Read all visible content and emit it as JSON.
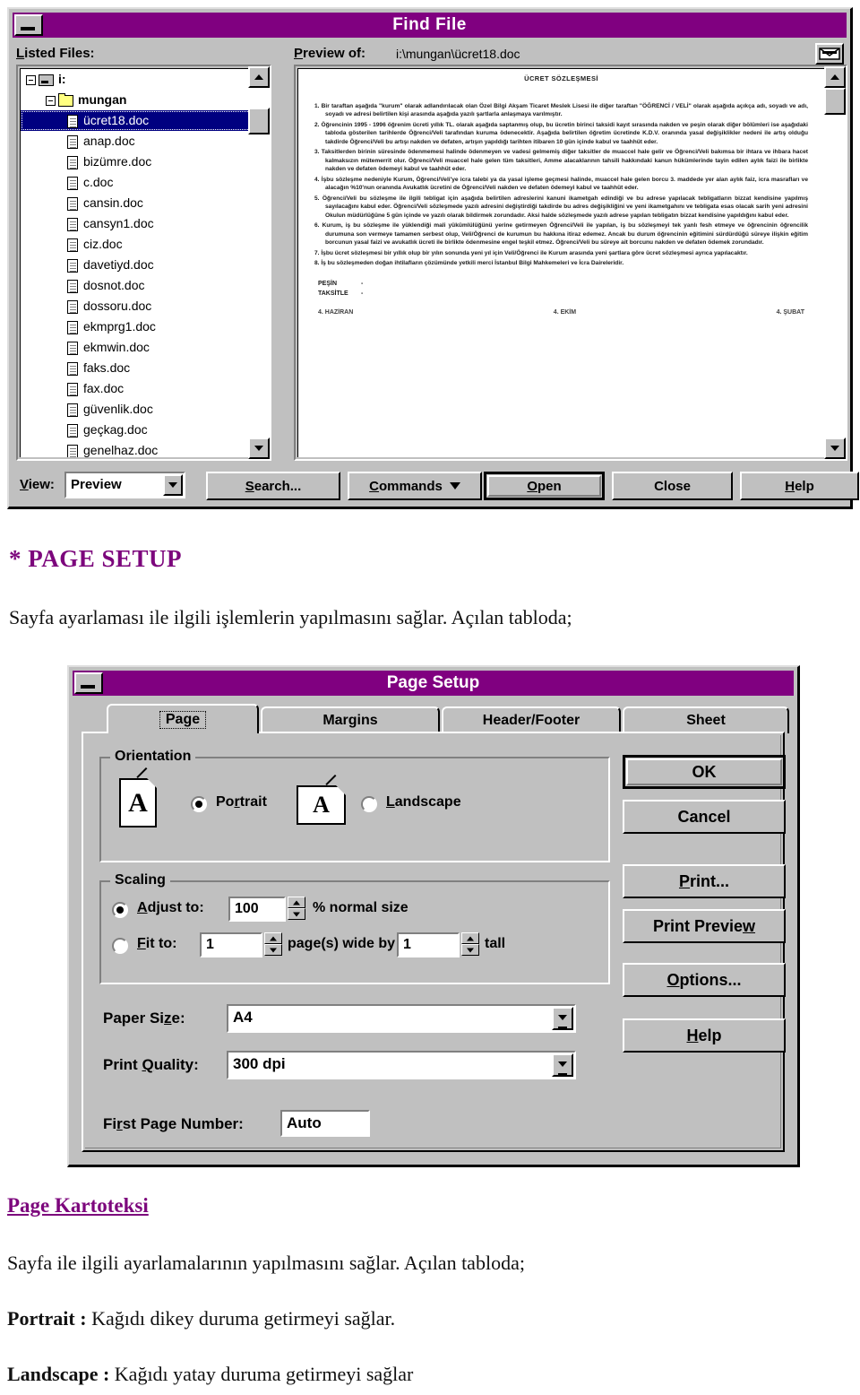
{
  "find_file": {
    "title": "Find File",
    "minimize_label": "Minimize",
    "listed_files_label": "Listed Files:",
    "preview_of_label": "Preview of:",
    "preview_path": "i:\\mungan\\ücret18.doc",
    "preview_toggle_icon": "envelope-icon",
    "tree": [
      {
        "label": "i:",
        "icon": "drive-icon",
        "indent": 0,
        "expander": true,
        "bold": true,
        "selected": false
      },
      {
        "label": "mungan",
        "icon": "folder-icon",
        "indent": 1,
        "expander": true,
        "bold": true,
        "selected": false
      },
      {
        "label": "ücret18.doc",
        "icon": "document-icon",
        "indent": 2,
        "expander": false,
        "bold": false,
        "selected": true
      },
      {
        "label": "anap.doc",
        "icon": "document-icon",
        "indent": 2,
        "expander": false,
        "bold": false,
        "selected": false
      },
      {
        "label": "bizümre.doc",
        "icon": "document-icon",
        "indent": 2,
        "expander": false,
        "bold": false,
        "selected": false
      },
      {
        "label": "c.doc",
        "icon": "document-icon",
        "indent": 2,
        "expander": false,
        "bold": false,
        "selected": false
      },
      {
        "label": "cansin.doc",
        "icon": "document-icon",
        "indent": 2,
        "expander": false,
        "bold": false,
        "selected": false
      },
      {
        "label": "cansyn1.doc",
        "icon": "document-icon",
        "indent": 2,
        "expander": false,
        "bold": false,
        "selected": false
      },
      {
        "label": "ciz.doc",
        "icon": "document-icon",
        "indent": 2,
        "expander": false,
        "bold": false,
        "selected": false
      },
      {
        "label": "davetiyd.doc",
        "icon": "document-icon",
        "indent": 2,
        "expander": false,
        "bold": false,
        "selected": false
      },
      {
        "label": "dosnot.doc",
        "icon": "document-icon",
        "indent": 2,
        "expander": false,
        "bold": false,
        "selected": false
      },
      {
        "label": "dossoru.doc",
        "icon": "document-icon",
        "indent": 2,
        "expander": false,
        "bold": false,
        "selected": false
      },
      {
        "label": "ekmprg1.doc",
        "icon": "document-icon",
        "indent": 2,
        "expander": false,
        "bold": false,
        "selected": false
      },
      {
        "label": "ekmwin.doc",
        "icon": "document-icon",
        "indent": 2,
        "expander": false,
        "bold": false,
        "selected": false
      },
      {
        "label": "faks.doc",
        "icon": "document-icon",
        "indent": 2,
        "expander": false,
        "bold": false,
        "selected": false
      },
      {
        "label": "fax.doc",
        "icon": "document-icon",
        "indent": 2,
        "expander": false,
        "bold": false,
        "selected": false
      },
      {
        "label": "güvenlik.doc",
        "icon": "document-icon",
        "indent": 2,
        "expander": false,
        "bold": false,
        "selected": false
      },
      {
        "label": "geçkag.doc",
        "icon": "document-icon",
        "indent": 2,
        "expander": false,
        "bold": false,
        "selected": false
      },
      {
        "label": "genelhaz.doc",
        "icon": "document-icon",
        "indent": 2,
        "expander": false,
        "bold": false,
        "selected": false
      }
    ],
    "document_preview": {
      "heading": "ÜCRET SÖZLEŞMESİ",
      "paragraphs": [
        "1. Bir taraftan aşağıda \"kurum\" olarak adlandırılacak olan Özel Bilgi Akşam Ticaret Meslek Lisesi ile diğer taraftan \"ÖĞRENCİ / VELİ\" olarak aşağıda açıkça adı, soyadı ve adı, soyadı ve adresi belirtilen kişi arasında aşağıda yazılı şartlarla anlaşmaya varılmıştır.",
        "2. Öğrencinin 1995 - 1996 öğrenim ücreti yıllık TL. olarak aşağıda saptanmış olup, bu ücretin birinci taksidi kayıt sırasında nakden ve peşin olarak diğer bölümleri ise aşağıdaki tabloda gösterilen tarihlerde Öğrenci/Veli tarafından kuruma ödenecektir. Aşağıda belirtilen öğretim ücretinde K.D.V. oranında yasal değişiklikler nedeni ile artış olduğu takdirde Öğrenci/Veli bu artışı nakden ve defaten, artışın yapıldığı tarihten itibaren 10 gün içinde kabul ve taahhüt eder.",
        "3. Taksitlerden birinin süresinde ödenmemesi halinde ödenmeyen ve vadesi gelmemiş diğer taksitler de muaccel hale gelir ve Öğrenci/Veli bakımsa bir ihtara ve ihbara hacet kalmaksızın mütemerrit olur. Öğrenci/Veli muaccel hale gelen tüm taksitleri, Amme alacaklarının tahsili hakkındaki kanun hükümlerinde tayin edilen aylık faizi ile birlikte nakden ve defaten ödemeyi kabul ve taahhüt eder.",
        "4. İşbu sözleşme nedeniyle Kurum, Öğrenci/Veli'ye icra talebi ya da yasal işleme geçmesi halinde, muaccel hale gelen borcu 3. maddede yer alan aylık faiz, icra masrafları ve alacağın %10'nun oranında Avukatlık ücretini de Öğrenci/Veli nakden ve defaten ödemeyi kabul ve taahhüt eder.",
        "5. Öğrenci/Veli bu sözleşme ile ilgili tebligat için aşağıda belirtilen adreslerini kanuni ikametgah edindiği ve bu adrese yapılacak tebligatların bizzat kendisine yapılmış sayılacağını kabul eder. Öğrenci/Veli sözleşmede yazılı adresini değiştirdiği takdirde bu adres değişikliğini ve yeni ikametgahını ve tebligata esas olacak sarih yeni adresini Okulun müdürlüğüne 5 gün içinde ve yazılı olarak bildirmek zorundadır. Aksi halde sözleşmede yazılı adrese yapılan tebligatın bizzat kendisine yapıldığını kabul eder.",
        "6. Kurum, iş bu sözleşme ile yüklendiği mali yükümlülüğünü yerine getirmeyen Öğrenci/Veli ile yapılan, iş bu sözleşmeyi tek yanlı fesh etmeye ve öğrencinin öğrencilik durumuna son vermeye tamamen serbest olup, Veli/Öğrenci de kurumun bu hakkına itiraz edemez. Ancak bu durum öğrencinin eğitimini sürdürdüğü süreye ilişkin eğitim borcunun yasal faizi ve avukatlık ücreti ile birlikte ödenmesine engel teşkil etmez. Öğrenci/Veli bu süreye ait borcunu nakden ve defaten ödemek zorundadır.",
        "7. İşbu ücret sözleşmesi bir yıllık olup bir yılın sonunda yeni yıl için Veli/Öğrenci ile Kurum arasında yeni şartlara göre ücret sözleşmesi ayrıca yapılacaktır.",
        "8. İş bu sözleşmeden doğan ihtilafların çözümünde yetkili merci İstanbul Bilgi Mahkemeleri ve İcra Daireleridir."
      ],
      "signature_lines": [
        {
          "label": "PEŞİN",
          "value": "-"
        },
        {
          "label": "TAKSİTLE",
          "value": "-"
        }
      ],
      "footer_cells": [
        "4. HAZİRAN",
        "4. EKİM",
        "4. ŞUBAT"
      ]
    },
    "toolbar": {
      "view_label": "View:",
      "view_value": "Preview",
      "search_label": "Search...",
      "commands_label": "Commands",
      "open_label": "Open",
      "close_label": "Close",
      "help_label": "Help"
    }
  },
  "body_text": {
    "heading_page_setup": "* PAGE SETUP",
    "intro": "Sayfa ayarlaması ile ilgili işlemlerin yapılmasını sağlar. Açılan tabloda;",
    "heading_kartoteksi": "Page Kartoteksi",
    "kart_text": "Sayfa ile ilgili ayarlamalarının yapılmasını sağlar. Açılan tabloda;",
    "portrait_term": "Portrait :",
    "portrait_desc": " Kağıdı dikey duruma getirmeyi sağlar.",
    "landscape_term": "Landscape :",
    "landscape_desc": " Kağıdı yatay duruma getirmeyi sağlar"
  },
  "page_setup": {
    "title": "Page Setup",
    "tabs": [
      {
        "label": "Page",
        "active": true
      },
      {
        "label": "Margins",
        "active": false
      },
      {
        "label": "Header/Footer",
        "active": false
      },
      {
        "label": "Sheet",
        "active": false
      }
    ],
    "orientation": {
      "group_label": "Orientation",
      "portrait_label": "Portrait",
      "landscape_label": "Landscape",
      "portrait_selected": true,
      "landscape_selected": false,
      "icon_glyph": "A"
    },
    "scaling": {
      "group_label": "Scaling",
      "adjust_label": "Adjust to:",
      "adjust_value": "100",
      "adjust_suffix": "% normal size",
      "adjust_selected": true,
      "fit_label": "Fit to:",
      "fit_width_value": "1",
      "fit_mid_text": "page(s) wide by",
      "fit_height_value": "1",
      "fit_suffix": "tall",
      "fit_selected": false
    },
    "paper_size_label": "Paper Size:",
    "paper_size_value": "A4",
    "print_quality_label": "Print Quality:",
    "print_quality_value": "300 dpi",
    "first_page_label": "First Page Number:",
    "first_page_value": "Auto",
    "buttons": {
      "ok": "OK",
      "cancel": "Cancel",
      "print": "Print...",
      "print_preview": "Print Preview",
      "options": "Options...",
      "help": "Help"
    }
  },
  "colors": {
    "titlebar": "#800080",
    "heading": "#7c067c",
    "face": "#c0c0c0",
    "selection": "#000080"
  }
}
